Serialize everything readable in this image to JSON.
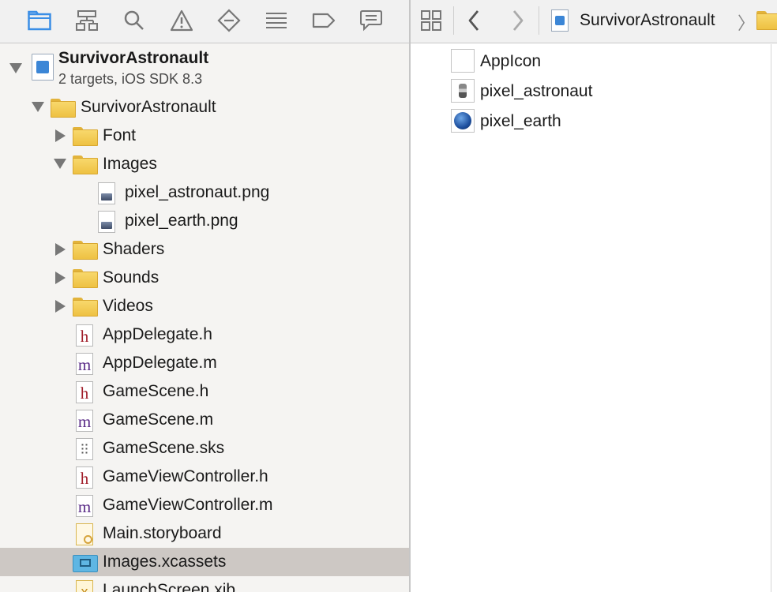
{
  "navigator": {
    "project": {
      "name": "SurvivorAstronault",
      "subtitle": "2 targets, iOS SDK 8.3"
    },
    "tree": [
      {
        "label": "SurvivorAstronault",
        "kind": "folder",
        "disclosure": "open"
      },
      {
        "label": "Font",
        "kind": "folder",
        "disclosure": "closed"
      },
      {
        "label": "Images",
        "kind": "folder",
        "disclosure": "open"
      },
      {
        "label": "pixel_astronaut.png",
        "kind": "png"
      },
      {
        "label": "pixel_earth.png",
        "kind": "png"
      },
      {
        "label": "Shaders",
        "kind": "folder",
        "disclosure": "closed"
      },
      {
        "label": "Sounds",
        "kind": "folder",
        "disclosure": "closed"
      },
      {
        "label": "Videos",
        "kind": "folder",
        "disclosure": "closed"
      },
      {
        "label": "AppDelegate.h",
        "kind": "h",
        "glyph": "h"
      },
      {
        "label": "AppDelegate.m",
        "kind": "m",
        "glyph": "m"
      },
      {
        "label": "GameScene.h",
        "kind": "h",
        "glyph": "h"
      },
      {
        "label": "GameScene.m",
        "kind": "m",
        "glyph": "m"
      },
      {
        "label": "GameScene.sks",
        "kind": "sks"
      },
      {
        "label": "GameViewController.h",
        "kind": "h",
        "glyph": "h"
      },
      {
        "label": "GameViewController.m",
        "kind": "m",
        "glyph": "m"
      },
      {
        "label": "Main.storyboard",
        "kind": "storyboard"
      },
      {
        "label": "Images.xcassets",
        "kind": "xcassets",
        "selected": true
      },
      {
        "label": "LaunchScreen.xib",
        "kind": "xib",
        "glyph": "x"
      }
    ],
    "toolbar_icons": [
      "folder-icon",
      "hierarchy-icon",
      "search-icon",
      "warning-icon",
      "breakpoint-diamond-icon",
      "list-icon",
      "tag-icon",
      "comment-icon"
    ]
  },
  "editor": {
    "breadcrumb": "SurvivorAstronault",
    "breadcrumb_chevron": "〉",
    "assets": [
      {
        "label": "AppIcon",
        "thumb": "blank"
      },
      {
        "label": "pixel_astronaut",
        "thumb": "astro"
      },
      {
        "label": "pixel_earth",
        "thumb": "earth"
      }
    ]
  },
  "colors": {
    "accent": "#3a8ee6",
    "selection": "#cdc8c4",
    "folder": "#f3ca4f"
  }
}
